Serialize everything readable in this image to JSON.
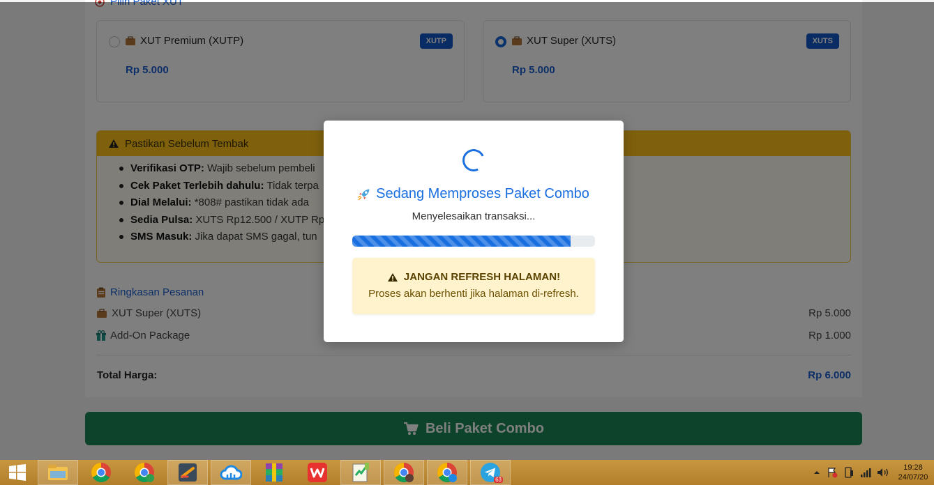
{
  "page": {
    "section_title": "Pilih Paket XUT",
    "packages": [
      {
        "name": "XUT Premium (XUTP)",
        "badge": "XUTP",
        "price": "Rp 5.000",
        "selected": false
      },
      {
        "name": "XUT Super (XUTS)",
        "badge": "XUTS",
        "price": "Rp 5.000",
        "selected": true
      }
    ],
    "warning": {
      "title": "Pastikan Sebelum Tembak",
      "items": [
        {
          "label": "Verifikasi OTP:",
          "text": "Wajib sebelum pembeli"
        },
        {
          "label": "Cek Paket Terlebih dahulu:",
          "text": "Tidak terpa"
        },
        {
          "label": "Dial Melalui:",
          "text": "*808# pastikan tidak ada"
        },
        {
          "label": "Sedia Pulsa:",
          "text": "XUTS Rp12.500 / XUTP Rp"
        },
        {
          "label": "SMS Masuk:",
          "text": "Jika dapat SMS gagal, tun"
        }
      ]
    },
    "summary": {
      "title": "Ringkasan Pesanan",
      "rows": [
        {
          "label": "XUT Super (XUTS)",
          "value": "Rp 5.000"
        },
        {
          "label": "Add-On Package",
          "value": "Rp 1.000"
        }
      ],
      "total_label": "Total Harga:",
      "total_value": "Rp 6.000"
    },
    "buy_button": "Beli Paket Combo"
  },
  "modal": {
    "title": "Sedang Memproses Paket Combo",
    "subtitle": "Menyelesaikan transaksi...",
    "progress_percent": 90,
    "alert_title": "JANGAN REFRESH HALAMAN!",
    "alert_text": "Proses akan berhenti jika halaman di-refresh."
  },
  "taskbar": {
    "apps": [
      {
        "icon": "file-explorer-icon"
      },
      {
        "icon": "chrome-icon"
      },
      {
        "icon": "chrome-profile-icon"
      },
      {
        "icon": "app-icon"
      },
      {
        "icon": "cloud-icon"
      },
      {
        "icon": "winrar-icon"
      },
      {
        "icon": "wps-office-icon"
      },
      {
        "icon": "notepad-plus-icon"
      },
      {
        "icon": "chrome-profile-icon"
      },
      {
        "icon": "chrome-profile-icon"
      },
      {
        "icon": "telegram-icon",
        "badge": "63"
      }
    ],
    "time": "19:28",
    "date": "24/07/20"
  },
  "colors": {
    "primary": "#1a6fe0",
    "warning": "#ffc31a",
    "success": "#1a8754",
    "alert_bg": "#fff3cd"
  }
}
